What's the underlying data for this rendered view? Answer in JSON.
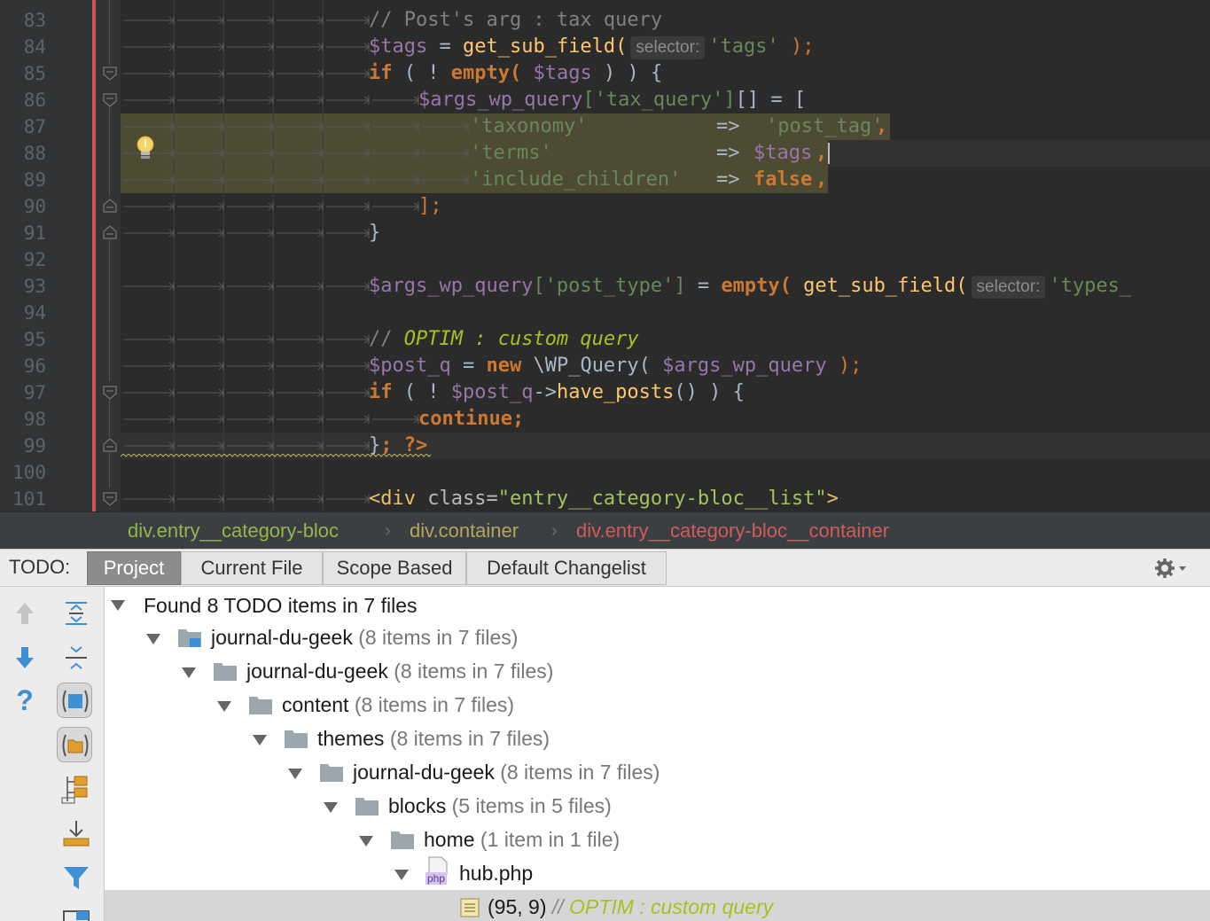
{
  "editor": {
    "line_numbers": [
      "83",
      "84",
      "85",
      "86",
      "87",
      "88",
      "89",
      "90",
      "91",
      "92",
      "93",
      "94",
      "95",
      "96",
      "97",
      "98",
      "99",
      "100",
      "101"
    ],
    "lines": {
      "l83": {
        "comment": "// Post's arg : tax query"
      },
      "l84": {
        "var": "$tags",
        "op": " = ",
        "fn": "get_sub_field(",
        "hint": "selector:",
        "str": "'tags'",
        "end": " );"
      },
      "l85": {
        "kw": "if",
        "p1": " ( ! ",
        "fn": "empty(",
        "var": " $tags",
        "end": " ) ) {"
      },
      "l86": {
        "var": "$args_wp_query",
        "str": "['tax_query']",
        "end": "[] = ["
      },
      "l87": {
        "key": "'taxonomy'",
        "arrow": "=>",
        "val": "'post_tag'",
        "end": ","
      },
      "l88": {
        "key": "'terms'",
        "arrow": "=>",
        "val": "$tags",
        "end": ","
      },
      "l89": {
        "key": "'include_children'",
        "arrow": "=>",
        "val": "false",
        "end": ","
      },
      "l90": {
        "end": "];"
      },
      "l91": {
        "end": "}"
      },
      "l93": {
        "var": "$args_wp_query",
        "str": "['post_type']",
        "op": " = ",
        "fn1": "empty(",
        "fn2": " get_sub_field(",
        "hint": "selector:",
        "str2": "'types_"
      },
      "l95": {
        "comment": "// ",
        "todo": "OPTIM : custom query"
      },
      "l96": {
        "var": "$post_q",
        "op": " = ",
        "kw": "new",
        "cls": " \\WP_Query(",
        "var2": " $args_wp_query",
        "end": " );"
      },
      "l97": {
        "kw": "if",
        "p1": " ( ! ",
        "var": "$post_q",
        "arrow": "->",
        "fn": "have_posts",
        "end": "() ) {"
      },
      "l98": {
        "kw": "continue;"
      },
      "l99": {
        "p1": "}",
        "kw": "; ?>"
      },
      "l101": {
        "tag_open": "<div",
        "attr": " class=",
        "attrval": "\"entry__category-bloc__list\"",
        "tag_close": ">"
      }
    }
  },
  "breadcrumbs": [
    {
      "label": "div.entry__category-bloc",
      "color": "#8fb84c"
    },
    {
      "label": "div.container",
      "color": "#b5a55a"
    },
    {
      "label": "div.entry__category-bloc__container",
      "color": "#cf5b5b"
    }
  ],
  "todo": {
    "label": "TODO:",
    "tabs": [
      "Project",
      "Current File",
      "Scope Based",
      "Default Changelist"
    ],
    "active_tab": "Project",
    "tree": [
      {
        "text": "Found 8 TODO items in 7 files",
        "count": ""
      },
      {
        "text": "journal-du-geek",
        "count": " (8 items in 7 files)"
      },
      {
        "text": "journal-du-geek",
        "count": " (8 items in 7 files)"
      },
      {
        "text": "content",
        "count": " (8 items in 7 files)"
      },
      {
        "text": "themes",
        "count": " (8 items in 7 files)"
      },
      {
        "text": "journal-du-geek",
        "count": " (8 items in 7 files)"
      },
      {
        "text": "blocks",
        "count": " (5 items in 5 files)"
      },
      {
        "text": "home",
        "count": " (1 item in 1 file)"
      },
      {
        "text": "hub.php",
        "count": ""
      }
    ],
    "selected_item": {
      "pos": "(95, 9)",
      "comment": "// ",
      "todo": "OPTIM : custom query"
    },
    "php_badge": "php"
  },
  "colors": {
    "editor_bg": "#2b2b2b",
    "gutter_bg": "#313335",
    "selection_bg": "#4d4b33",
    "todo_green": "#a8c023",
    "active_tab": "#8c8c8c"
  }
}
